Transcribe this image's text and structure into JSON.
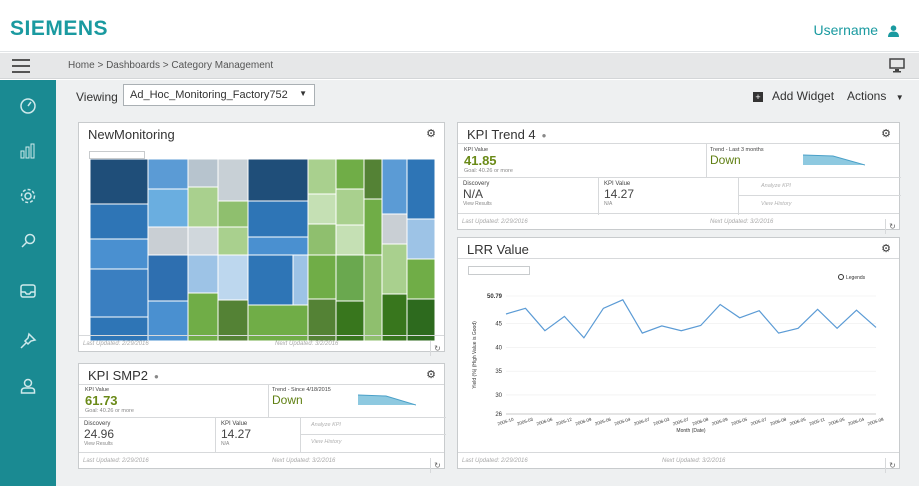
{
  "app": {
    "logo": "SIEMENS",
    "username": "Username"
  },
  "breadcrumb": "Home > Dashboards > Category Management",
  "viewbar": {
    "label": "Viewing",
    "selected": "Ad_Hoc_Monitoring_Factory752",
    "add_widget": "Add Widget",
    "actions": "Actions"
  },
  "sidebar": [
    "gauge-icon",
    "bar-chart-icon",
    "gear-icon",
    "search-icon",
    "inbox-icon",
    "pin-icon",
    "user-icon"
  ],
  "widgets": {
    "new_monitoring": {
      "title": "NewMonitoring",
      "footer_left": "Last Updated: 2/29/2016",
      "footer_right": "Next Updated: 3/2/2016"
    },
    "kpi_trend": {
      "title": "KPI Trend 4",
      "kpi_label": "KPI Value",
      "kpi_value": "41.85",
      "kpi_goal": "Goal: 40.26 or more",
      "trend_label": "Trend - Last 3 months",
      "trend_value": "Down",
      "discovery_label": "Discovery",
      "discovery_value": "N/A",
      "discovery_link": "View Results",
      "kpi2_label": "KPI Value",
      "kpi2_value": "14.27",
      "kpi2_sub": "N/A",
      "analyze": "Analyze KPI",
      "history": "View History",
      "footer_left": "Last Updated: 2/29/2016",
      "footer_right": "Next Updated: 3/2/2016"
    },
    "kpi_smp": {
      "title": "KPI SMP2",
      "kpi_label": "KPI Value",
      "kpi_value": "61.73",
      "kpi_goal": "Goal: 40.26 or more",
      "trend_label": "Trend - Since 4/18/2015",
      "trend_value": "Down",
      "discovery_label": "Discovery",
      "discovery_value": "24.96",
      "discovery_link": "View Results",
      "kpi2_label": "KPI Value",
      "kpi2_value": "14.27",
      "kpi2_sub": "N/A",
      "analyze": "Analyze KPI",
      "history": "View History",
      "footer_left": "Last Updated: 2/29/2016",
      "footer_right": "Next Updated: 3/2/2016"
    },
    "lrr": {
      "title": "LRR Value",
      "legend": "Legends",
      "footer_left": "Last Updated: 2/29/2016",
      "footer_right": "Next Updated: 3/2/2016"
    }
  },
  "colors": {
    "teal": "#1a8a92",
    "brand": "#1a9aa0",
    "kpi_green": "#6a8a18",
    "line": "#5b9bd5"
  },
  "chart_data": {
    "type": "line",
    "ylabel": "Yield (%) (High Value is Good)",
    "xlabel": "Month (Date)",
    "ylim": [
      26,
      50.79
    ],
    "yticks": [
      26,
      30,
      35,
      40,
      45,
      50.79
    ],
    "categories": [
      "2005-10",
      "2005-03",
      "2006-06",
      "2005-12",
      "2006-09",
      "2005-06",
      "2005-04",
      "2006-07",
      "2006-03",
      "2005-07",
      "2006-08",
      "2005-09",
      "2005-05",
      "2005-07",
      "2006-08",
      "2006-05",
      "2005-11",
      "2006-05",
      "2006-04",
      "2005-08"
    ],
    "series": [
      {
        "values": [
          47.0,
          48.2,
          43.5,
          46.5,
          42.0,
          48.2,
          50.0,
          43.0,
          44.5,
          43.5,
          44.6,
          49.0,
          46.2,
          47.7,
          43.0,
          44.0,
          48.0,
          44.0,
          47.8,
          44.2
        ]
      }
    ]
  }
}
